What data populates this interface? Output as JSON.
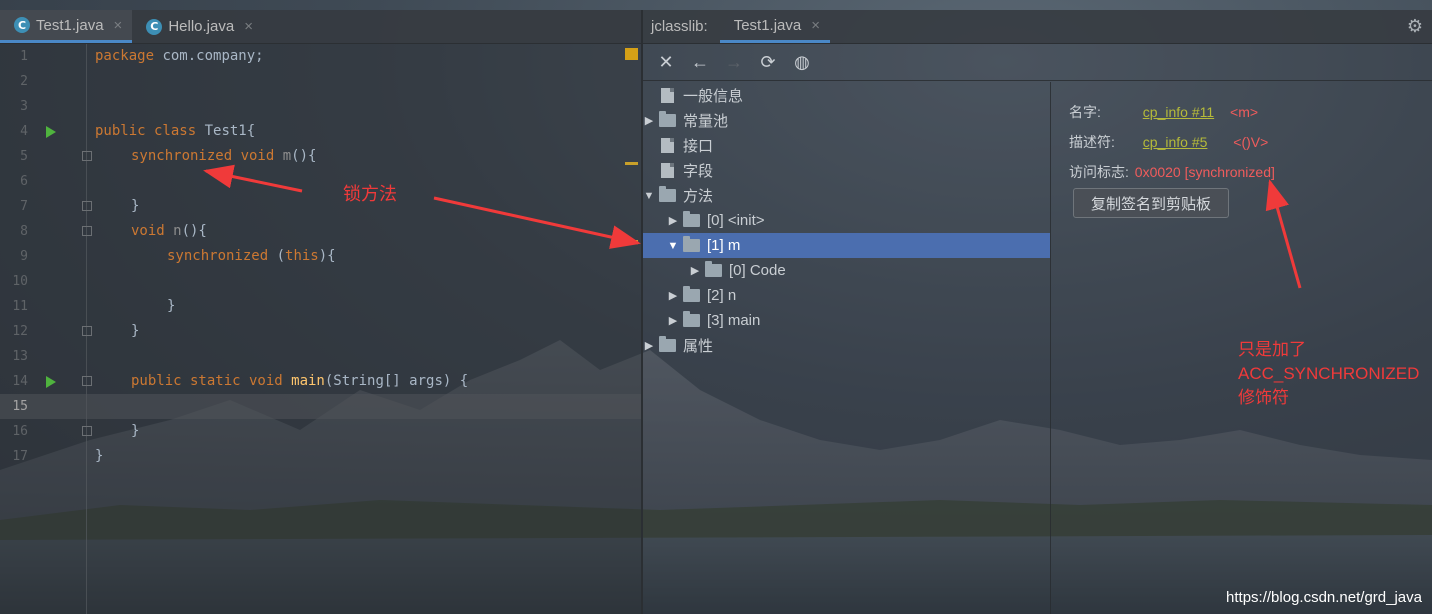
{
  "editor": {
    "tabs": [
      {
        "label": "Test1.java",
        "icon": "java-class-icon",
        "active": true
      },
      {
        "label": "Hello.java",
        "icon": "java-class-icon",
        "active": false
      }
    ],
    "current_line": 15,
    "lines": [
      {
        "no": "1"
      },
      {
        "no": "2"
      },
      {
        "no": "3"
      },
      {
        "no": "4"
      },
      {
        "no": "5"
      },
      {
        "no": "6"
      },
      {
        "no": "7"
      },
      {
        "no": "8"
      },
      {
        "no": "9"
      },
      {
        "no": "10"
      },
      {
        "no": "11"
      },
      {
        "no": "12"
      },
      {
        "no": "13"
      },
      {
        "no": "14"
      },
      {
        "no": "15"
      },
      {
        "no": "16"
      },
      {
        "no": "17"
      }
    ],
    "code": {
      "l1_kw": "package",
      "l1_rest": " com.company;",
      "l4_kw": "public class",
      "l4_rest": " Test1{",
      "l5_kw": "synchronized void",
      "l5_name": " m",
      "l5_rest": "(){",
      "l7": "}",
      "l8_kw": "void",
      "l8_name": " n",
      "l8_rest": "(){",
      "l9_kw": "synchronized",
      "l9_p1": " (",
      "l9_this": "this",
      "l9_p2": "){",
      "l11": "}",
      "l12": "}",
      "l14_kw": "public static void",
      "l14_name": " main",
      "l14_rest": "(String[] args) {",
      "l16": "}",
      "l17": "}"
    }
  },
  "jclasslib": {
    "title": "jclasslib:",
    "tab": "Test1.java",
    "toolbar": [
      "close-icon",
      "back-arrow-icon",
      "forward-arrow-icon",
      "refresh-icon",
      "web-icon"
    ],
    "tree": {
      "general": "一般信息",
      "constant_pool": "常量池",
      "interfaces": "接口",
      "fields": "字段",
      "methods": "方法",
      "m0": "[0] <init>",
      "m1": "[1] m",
      "m1_code": "[0] Code",
      "m2": "[2] n",
      "m3": "[3] main",
      "attributes": "属性"
    },
    "detail": {
      "name_label": "名字:",
      "name_link": "cp_info #11",
      "name_value": "<m>",
      "desc_label": "描述符:",
      "desc_link": "cp_info #5",
      "desc_value": "<()V>",
      "access_label": "访问标志:",
      "access_value": "0x0020 [synchronized]",
      "copy_button": "复制签名到剪贴板"
    }
  },
  "annotations": {
    "lock_method": "锁方法",
    "note_line1": "只是加了",
    "note_line2": "ACC_SYNCHRONIZED",
    "note_line3": "修饰符"
  },
  "watermark": "https://blog.csdn.net/grd_java",
  "colors": {
    "keyword": "#cc7832",
    "function": "#ffc66d",
    "selection": "#4b6eaf",
    "annotation": "#f03a3a",
    "link": "#b5ba3a"
  }
}
